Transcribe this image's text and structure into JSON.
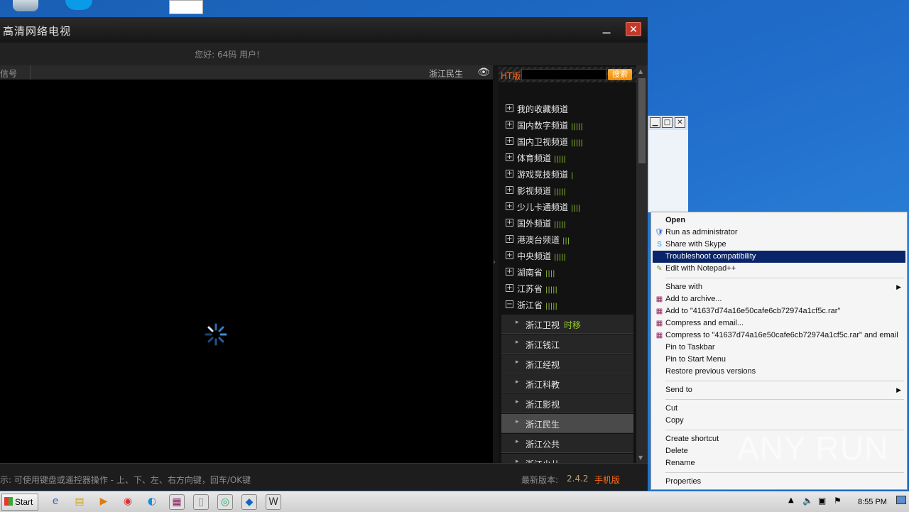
{
  "player": {
    "title": "高清网络电视",
    "greeting": "您好: 64码 用户!",
    "signal_label": "信号",
    "current_channel": "浙江民生",
    "search": {
      "brand": "HT版",
      "button": "搜索",
      "placeholder": ""
    },
    "categories": [
      {
        "label": "我的收藏频道",
        "expanded": false,
        "bars": ""
      },
      {
        "label": "国内数字频道",
        "expanded": false,
        "bars": "|||||"
      },
      {
        "label": "国内卫视频道",
        "expanded": false,
        "bars": "|||||"
      },
      {
        "label": "体育频道",
        "expanded": false,
        "bars": "|||||"
      },
      {
        "label": "游戏竞技频道",
        "expanded": false,
        "bars": "|"
      },
      {
        "label": "影视频道",
        "expanded": false,
        "bars": "|||||"
      },
      {
        "label": "少儿卡通频道",
        "expanded": false,
        "bars": "||||"
      },
      {
        "label": "国外频道",
        "expanded": false,
        "bars": "|||||"
      },
      {
        "label": "港澳台频道",
        "expanded": false,
        "bars": "|||"
      },
      {
        "label": "中央频道",
        "expanded": false,
        "bars": "|||||"
      },
      {
        "label": "湖南省",
        "expanded": false,
        "bars": "||||"
      },
      {
        "label": "江苏省",
        "expanded": false,
        "bars": "|||||"
      },
      {
        "label": "浙江省",
        "expanded": true,
        "bars": "|||||"
      }
    ],
    "channels": [
      {
        "label": "浙江卫视",
        "tag": "时移",
        "active": false
      },
      {
        "label": "浙江钱江",
        "tag": "",
        "active": false
      },
      {
        "label": "浙江经视",
        "tag": "",
        "active": false
      },
      {
        "label": "浙江科教",
        "tag": "",
        "active": false
      },
      {
        "label": "浙江影视",
        "tag": "",
        "active": false
      },
      {
        "label": "浙江民生",
        "tag": "",
        "active": true
      },
      {
        "label": "浙江公共",
        "tag": "",
        "active": false
      },
      {
        "label": "浙江少儿",
        "tag": "",
        "active": false
      }
    ],
    "status_tip": "示: 可使用键盘或遥控器操作 - 上、下、左、右方向键，回车/OK键",
    "version_label": "最新版本:",
    "version": "2.4.2",
    "mobile_link": "手机版"
  },
  "context_menu": {
    "items": [
      {
        "label": "Open",
        "bold": true,
        "icon": "",
        "highlight": false,
        "submenu": false,
        "sep_before": false
      },
      {
        "label": "Run as administrator",
        "icon": "shield-icon",
        "highlight": false,
        "submenu": false,
        "sep_before": false
      },
      {
        "label": "Share with Skype",
        "icon": "skype-icon",
        "highlight": false,
        "submenu": false,
        "sep_before": false
      },
      {
        "label": "Troubleshoot compatibility",
        "icon": "",
        "highlight": true,
        "submenu": false,
        "sep_before": false
      },
      {
        "label": "Edit with Notepad++",
        "icon": "notepad-icon",
        "highlight": false,
        "submenu": false,
        "sep_before": false
      },
      {
        "label": "Share with",
        "icon": "",
        "highlight": false,
        "submenu": true,
        "sep_before": true
      },
      {
        "label": "Add to archive...",
        "icon": "winrar-icon",
        "highlight": false,
        "submenu": false,
        "sep_before": false
      },
      {
        "label": "Add to \"41637d74a16e50cafe6cb72974a1cf5c.rar\"",
        "icon": "winrar-icon",
        "highlight": false,
        "submenu": false,
        "sep_before": false
      },
      {
        "label": "Compress and email...",
        "icon": "winrar-icon",
        "highlight": false,
        "submenu": false,
        "sep_before": false
      },
      {
        "label": "Compress to \"41637d74a16e50cafe6cb72974a1cf5c.rar\" and email",
        "icon": "winrar-icon",
        "highlight": false,
        "submenu": false,
        "sep_before": false
      },
      {
        "label": "Pin to Taskbar",
        "icon": "",
        "highlight": false,
        "submenu": false,
        "sep_before": false
      },
      {
        "label": "Pin to Start Menu",
        "icon": "",
        "highlight": false,
        "submenu": false,
        "sep_before": false
      },
      {
        "label": "Restore previous versions",
        "icon": "",
        "highlight": false,
        "submenu": false,
        "sep_before": false
      },
      {
        "label": "Send to",
        "icon": "",
        "highlight": false,
        "submenu": true,
        "sep_before": true
      },
      {
        "label": "Cut",
        "icon": "",
        "highlight": false,
        "submenu": false,
        "sep_before": true
      },
      {
        "label": "Copy",
        "icon": "",
        "highlight": false,
        "submenu": false,
        "sep_before": false
      },
      {
        "label": "Create shortcut",
        "icon": "",
        "highlight": false,
        "submenu": false,
        "sep_before": true
      },
      {
        "label": "Delete",
        "icon": "",
        "highlight": false,
        "submenu": false,
        "sep_before": false
      },
      {
        "label": "Rename",
        "icon": "",
        "highlight": false,
        "submenu": false,
        "sep_before": false
      },
      {
        "label": "Properties",
        "icon": "",
        "highlight": false,
        "submenu": false,
        "sep_before": true
      }
    ]
  },
  "watermark": "ANY RUN",
  "taskbar": {
    "start_label": "Start",
    "apps": [
      "ie-icon",
      "explorer-icon",
      "media-player-icon",
      "chrome-icon",
      "edge-icon",
      "winrar-icon",
      "notepad-icon",
      "app-icon",
      "vscode-icon",
      "wordpress-icon"
    ],
    "clock": "8:55 PM"
  },
  "colors": {
    "accent": "#ff6a1a",
    "signal_green": "#9acd32",
    "menu_highlight": "#0a246a",
    "close_red": "#c0392b"
  }
}
